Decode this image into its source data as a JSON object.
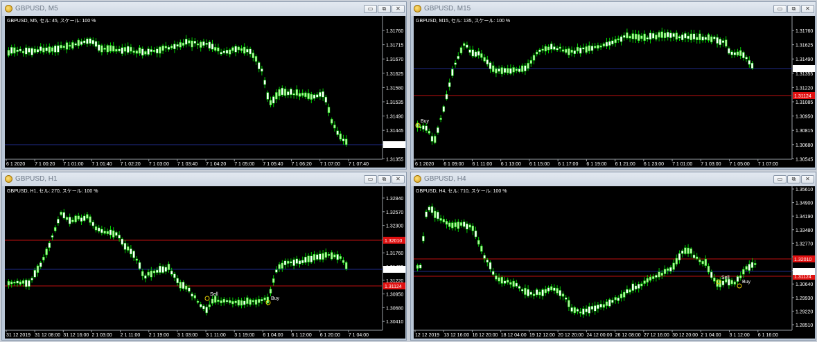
{
  "charts": [
    {
      "window_title": "GBPUSD, M5",
      "info": "GBPUSD, M5, セル: 45, スケール: 100 %",
      "price_ticks": [
        "1.31760",
        "1.31715",
        "1.31670",
        "1.31625",
        "1.31580",
        "1.31535",
        "1.31490",
        "1.31445",
        "1.31400",
        "1.31355"
      ],
      "time_ticks": [
        "6 1 2020",
        "7 1 00:20",
        "7 1 01:00",
        "7 1 01:40",
        "7 1 02:20",
        "7 1 03:00",
        "7 1 03:40",
        "7 1 04:20",
        "7 1 05:00",
        "7 1 05:40",
        "7 1 06:20",
        "7 1 07:00",
        "7 1 07:40"
      ],
      "current_price": "1.31400",
      "level_lines": [],
      "markers": []
    },
    {
      "window_title": "GBPUSD, M15",
      "info": "GBPUSD, M15, セル: 135, スケール: 100 %",
      "price_ticks": [
        "1.31760",
        "1.31625",
        "1.31490",
        "1.31355",
        "1.31220",
        "1.31085",
        "1.30950",
        "1.30815",
        "1.30680",
        "1.30545"
      ],
      "time_ticks": [
        "6 1 2020",
        "6 1 09:00",
        "6 1 11:00",
        "6 1 13:00",
        "6 1 15:00",
        "6 1 17:00",
        "6 1 19:00",
        "6 1 21:00",
        "6 1 23:00",
        "7 1 01:00",
        "7 1 03:00",
        "7 1 05:00",
        "7 1 07:00"
      ],
      "current_price": "1.31400",
      "level_lines": [
        "1.31124"
      ],
      "markers": [
        "Buy"
      ]
    },
    {
      "window_title": "GBPUSD, H1",
      "info": "GBPUSD, H1, セル: 270, スケール: 100 %",
      "price_ticks": [
        "1.32840",
        "1.32570",
        "1.32300",
        "1.32030",
        "1.31760",
        "1.31490",
        "1.31220",
        "1.30950",
        "1.30680",
        "1.30410"
      ],
      "time_ticks": [
        "31 12 2019",
        "31 12 08:00",
        "31 12 16:00",
        "2 1 03:00",
        "2 1 11:00",
        "2 1 19:00",
        "3 1 03:00",
        "3 1 11:00",
        "3 1 19:00",
        "6 1 04:00",
        "6 1 12:00",
        "6 1 20:00",
        "7 1 04:00"
      ],
      "current_price": "1.31400",
      "level_lines": [
        "1.32010",
        "1.31124"
      ],
      "markers": [
        "Sell",
        "Buy"
      ]
    },
    {
      "window_title": "GBPUSD, H4",
      "info": "GBPUSD, H4, セル: 710, スケール: 100 %",
      "price_ticks": [
        "1.35610",
        "1.34900",
        "1.34190",
        "1.33480",
        "1.32770",
        "1.32060",
        "1.31350",
        "1.30640",
        "1.29930",
        "1.29220",
        "1.28510"
      ],
      "time_ticks": [
        "12 12 2019",
        "13 12 16:00",
        "16 12 20:00",
        "18 12 04:00",
        "19 12 12:00",
        "20 12 20:00",
        "24 12 00:00",
        "26 12 08:00",
        "27 12 16:00",
        "30 12 20:00",
        "2 1 04:00",
        "3 1 12:00",
        "6 1 16:00"
      ],
      "current_price": "1.31400",
      "level_lines": [
        "1.32010",
        "1.31124"
      ],
      "markers": [
        "Sell",
        "Buy"
      ]
    }
  ],
  "window_buttons": [
    "▭",
    "⧉",
    "✕"
  ],
  "colors": {
    "bull": "#aef59a",
    "bear": "#ffffff",
    "wick": "#00d000",
    "current": "#1f2c8a",
    "level": "#c01010",
    "level_label_bg": "#e01010"
  }
}
